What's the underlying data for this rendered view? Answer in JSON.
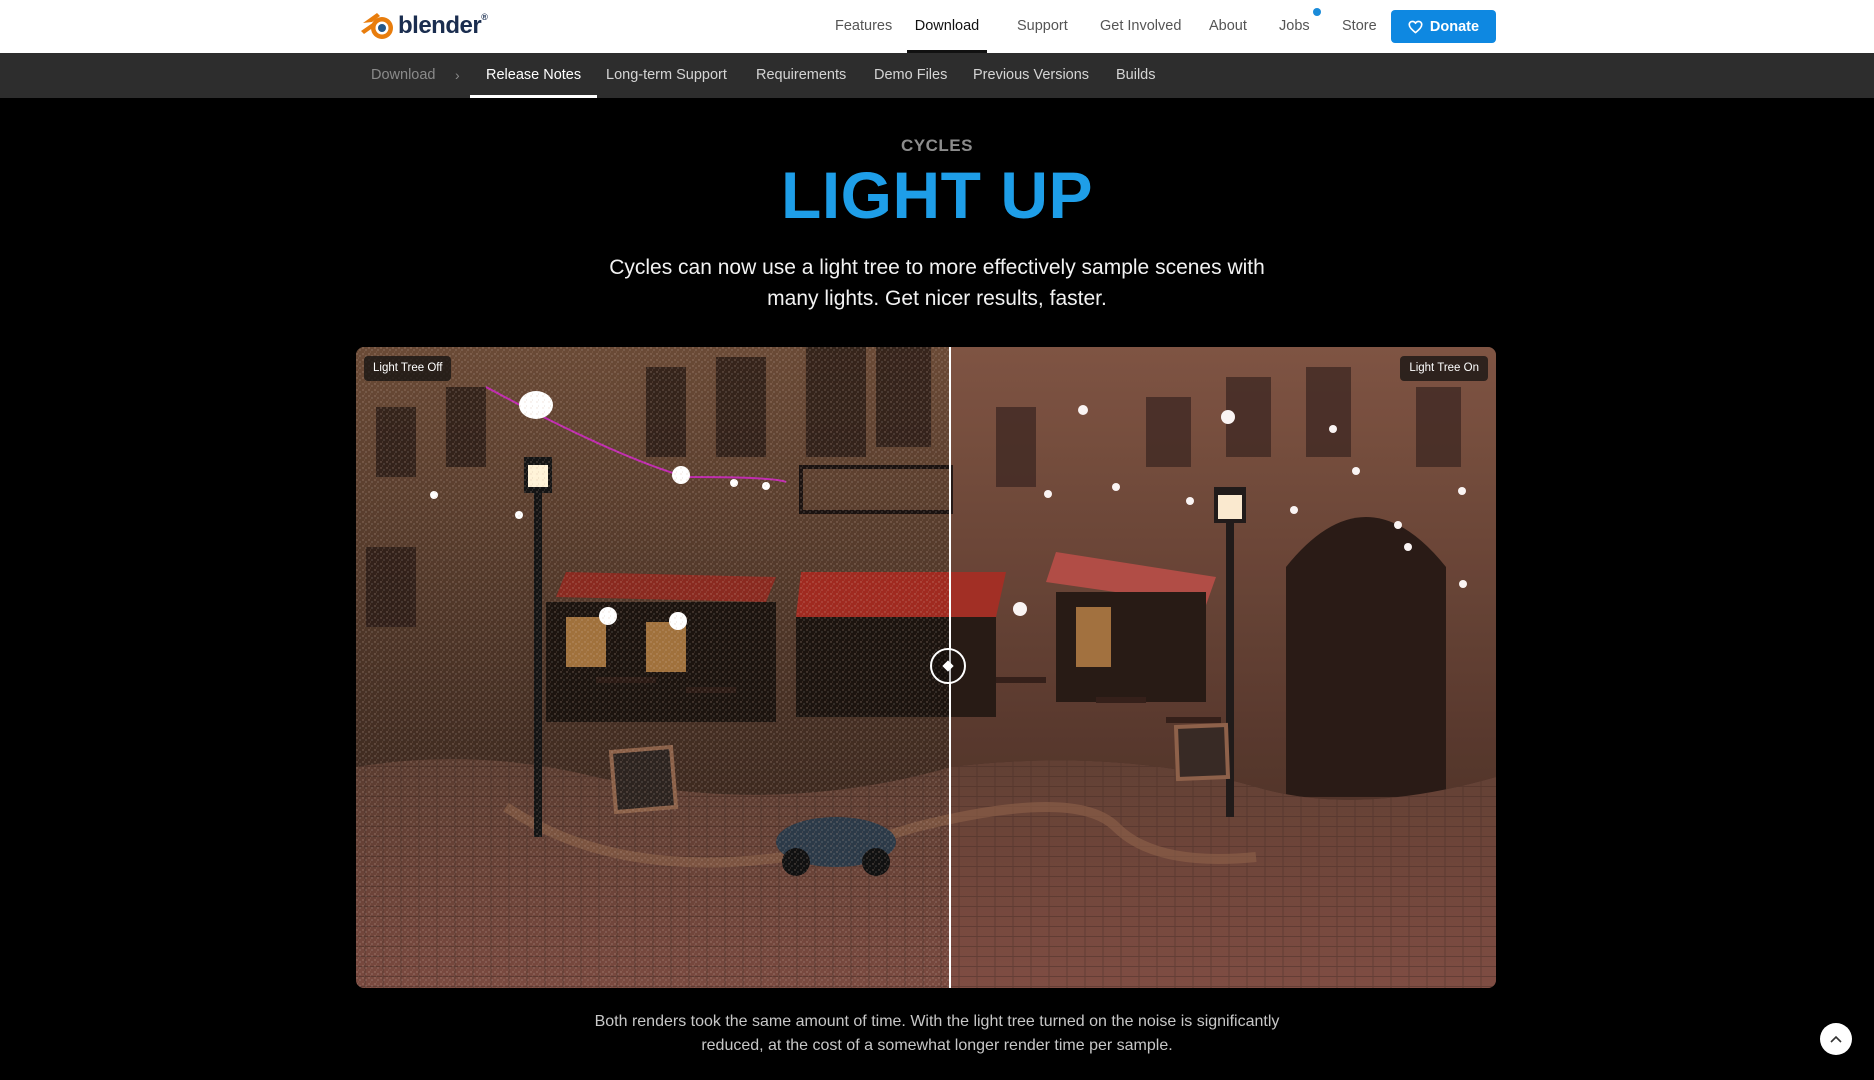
{
  "header": {
    "logo_text": "blender",
    "nav": [
      {
        "label": "Features"
      },
      {
        "label": "Download",
        "active": true
      },
      {
        "label": "Support"
      },
      {
        "label": "Get Involved"
      },
      {
        "label": "About"
      },
      {
        "label": "Jobs",
        "has_notification_dot": true
      },
      {
        "label": "Store"
      }
    ],
    "donate_label": "Donate",
    "brand_color": "#0e88e1"
  },
  "subnav": {
    "breadcrumb_root": "Download",
    "items": [
      {
        "label": "Release Notes",
        "active": true
      },
      {
        "label": "Long-term Support"
      },
      {
        "label": "Requirements"
      },
      {
        "label": "Demo Files"
      },
      {
        "label": "Previous Versions"
      },
      {
        "label": "Builds"
      }
    ]
  },
  "hero": {
    "eyebrow": "CYCLES",
    "headline_light": "LIGHT",
    "headline_bold": "UP",
    "lede": "Cycles can now use a light tree to more effectively sample scenes with many lights. Get nicer results, faster.",
    "accent_color": "#1e9ee8"
  },
  "comparison": {
    "left_label": "Light Tree Off",
    "right_label": "Light Tree On",
    "slider_position_percent": 52
  },
  "caption": "Both renders took the same amount of time. With the light tree turned on the noise is significantly reduced, at the cost of a somewhat longer render time per sample.",
  "icons": {
    "logo": "blender-logo-icon",
    "donate": "heart-icon",
    "breadcrumb": "chevron-right-icon",
    "slider": "slider-handle-icon",
    "back_to_top": "chevron-up-icon"
  }
}
